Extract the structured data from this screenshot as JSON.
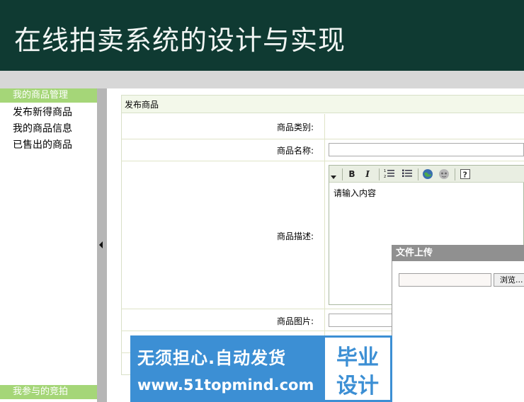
{
  "header": {
    "title": "在线拍卖系统的设计与实现"
  },
  "sidebar": {
    "section1": "我的商品管理",
    "items": [
      "发布新得商品",
      "我的商品信息",
      "已售出的商品"
    ],
    "section2": "我参与的竞拍"
  },
  "form": {
    "title": "发布商品",
    "category_label": "商品类别:",
    "name_label": "商品名称:",
    "desc_label": "商品描述:",
    "image_label": "商品图片:",
    "editor_placeholder": "请输入内容"
  },
  "editor_toolbar": {
    "bold": "B",
    "italic": "I",
    "icons": [
      "ordered-list-icon",
      "unordered-list-icon",
      "insert-image-icon",
      "insert-emoticon-icon",
      "help-icon"
    ]
  },
  "upload_dialog": {
    "title": "文件上传",
    "browse_label": "浏览..."
  },
  "banner": {
    "line1": "无须担心.自动发货",
    "line2": "www.51topmind.com",
    "box_line1": "毕业",
    "box_line2": "设计"
  },
  "colors": {
    "header_bg": "#0f3a32",
    "sidebar_accent": "#a5d678",
    "banner_blue": "#3c8fd4"
  }
}
